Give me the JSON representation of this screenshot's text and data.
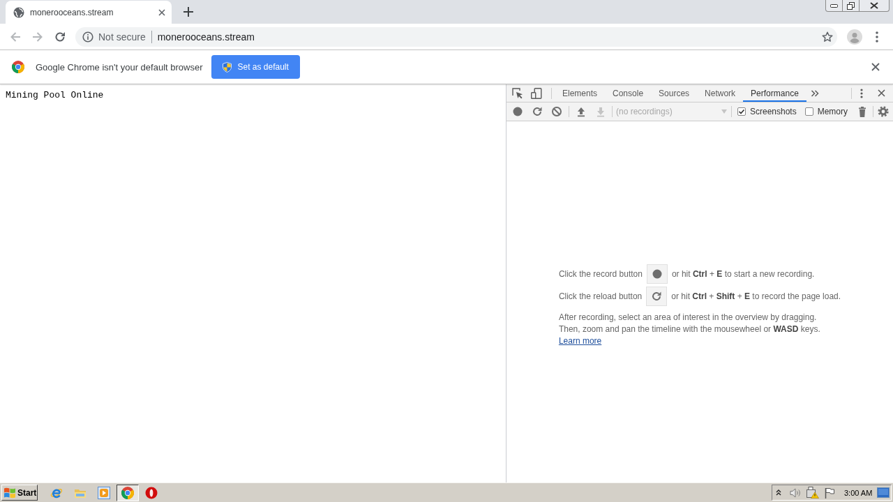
{
  "browser_tab": {
    "title": "monerooceans.stream"
  },
  "nav_buttons": [
    {
      "kind": "back",
      "disabled": true
    },
    {
      "kind": "forward",
      "disabled": true
    },
    {
      "kind": "reload",
      "disabled": false
    }
  ],
  "address_bar": {
    "security_label": "Not secure",
    "url": "monerooceans.stream"
  },
  "infobar": {
    "message": "Google Chrome isn't your default browser",
    "button": "Set as default"
  },
  "page": {
    "text": "Mining Pool Online"
  },
  "devtools": {
    "tabs": [
      {
        "label": "Elements",
        "selected": false
      },
      {
        "label": "Console",
        "selected": false
      },
      {
        "label": "Sources",
        "selected": false
      },
      {
        "label": "Network",
        "selected": false
      },
      {
        "label": "Performance",
        "selected": true
      }
    ],
    "toolbar_buttons": [
      {
        "kind": "record",
        "disabled": false
      },
      {
        "kind": "reload",
        "disabled": false
      },
      {
        "kind": "clear",
        "disabled": false
      },
      {
        "kind": "load",
        "disabled": false
      },
      {
        "kind": "save",
        "disabled": true
      }
    ],
    "recordings": {
      "value": "(no recordings)",
      "disabled": true
    },
    "options": [
      {
        "label": "Screenshots",
        "checked": true
      },
      {
        "label": "Memory",
        "checked": false
      }
    ],
    "landing": {
      "hints": [
        {
          "kind": "record",
          "before": "Click the record button",
          "after": "or hit **Ctrl** + **E** to start a new recording."
        },
        {
          "kind": "reload",
          "before": "Click the reload button",
          "after": "or hit **Ctrl** + **Shift** + **E** to record the page load."
        }
      ],
      "paragraph": [
        "After recording, select an area of interest in the overview by dragging.",
        "Then, zoom and pan the timeline with the mousewheel or **WASD** keys."
      ],
      "link": "Learn more"
    }
  },
  "taskbar": {
    "start": "Start",
    "apps": [
      {
        "kind": "e-logo",
        "selected": false
      },
      {
        "kind": "folder",
        "selected": false
      },
      {
        "kind": "play",
        "selected": false
      },
      {
        "kind": "browser",
        "selected": true
      },
      {
        "kind": "o-logo",
        "selected": false
      }
    ],
    "clock": "3:00 AM"
  }
}
